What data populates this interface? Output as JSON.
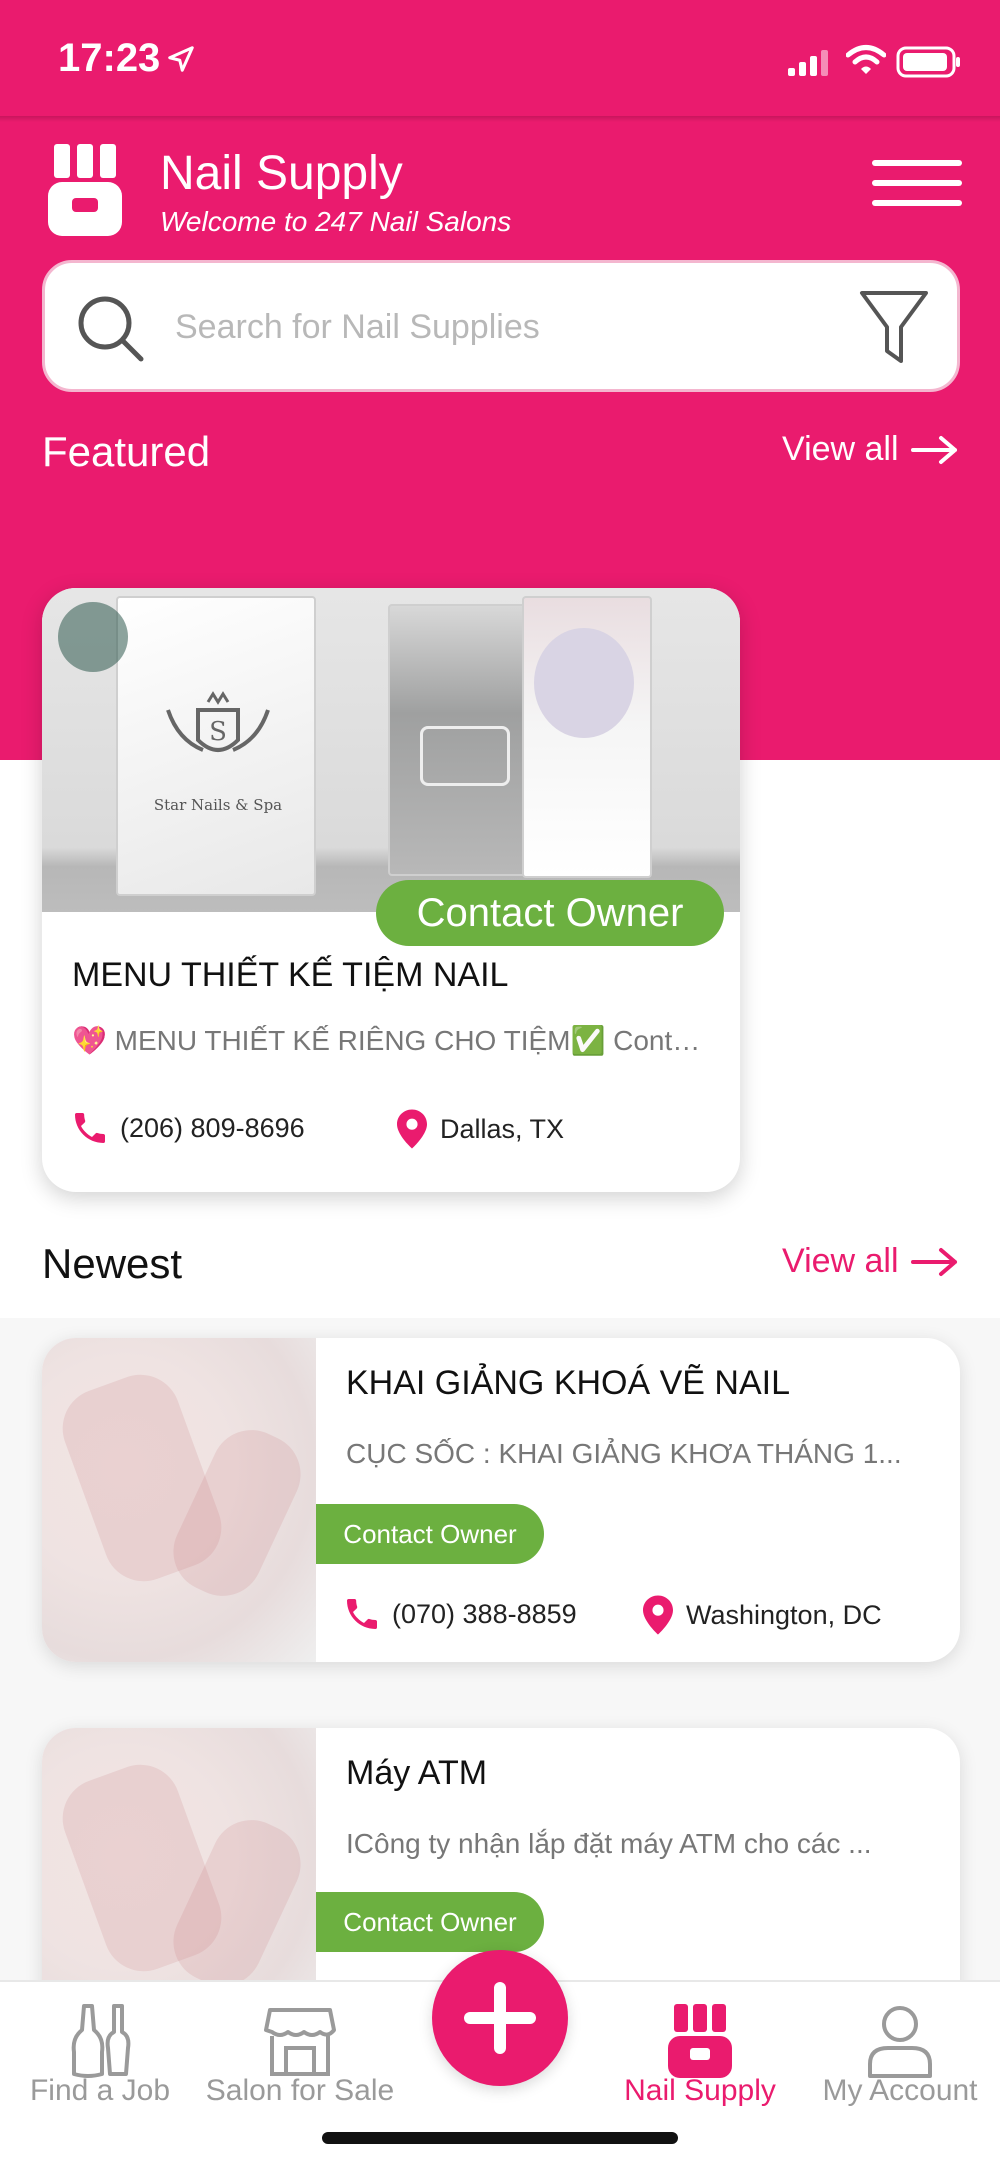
{
  "status_bar": {
    "time": "17:23"
  },
  "header": {
    "title": "Nail Supply",
    "subtitle": "Welcome to 247 Nail Salons"
  },
  "search": {
    "placeholder": "Search for Nail Supplies"
  },
  "featured": {
    "section_title": "Featured",
    "view_all": "View all",
    "card": {
      "contact_label": "Contact Owner",
      "title": "MENU THIẾT KẾ TIỆM NAIL",
      "description": "💖 MENU THIẾT KẾ RIÊNG CHO TIỆM✅ Content...",
      "phone": "(206) 809-8696",
      "location": "Dallas, TX",
      "image_text": {
        "brand": "Star Nails & Spa"
      }
    }
  },
  "newest": {
    "section_title": "Newest",
    "view_all": "View all",
    "items": [
      {
        "title": "KHAI GIẢNG KHOÁ VẼ NAIL",
        "description": "CỤC SỐC : KHAI GIẢNG KHƠA THÁNG 1...",
        "contact_label": "Contact Owner",
        "phone": "(070) 388-8859",
        "location": "Washington, DC"
      },
      {
        "title": "Máy ATM",
        "description": "ICông ty nhận lắp đặt máy ATM cho các ...",
        "contact_label": "Contact Owner"
      }
    ]
  },
  "tabs": [
    {
      "label": "Find a Job",
      "icon": "nail-polish-icon"
    },
    {
      "label": "Salon for Sale",
      "icon": "store-icon"
    },
    {
      "label": "Nail Supply",
      "icon": "nail-supply-icon",
      "active": true
    },
    {
      "label": "My Account",
      "icon": "user-icon"
    }
  ],
  "colors": {
    "brand_pink": "#ea1b6e",
    "contact_green": "#6cb040",
    "inactive_tab": "#9a9a9a"
  }
}
